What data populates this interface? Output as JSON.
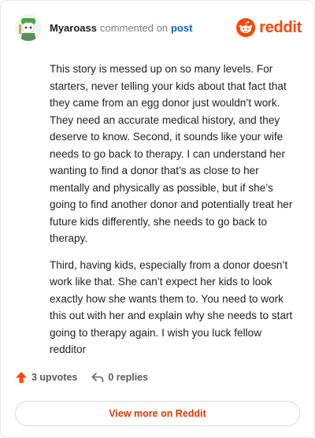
{
  "header": {
    "username": "Myaroass",
    "verb": "commented on",
    "post_link": "post",
    "logo_text": "reddit"
  },
  "comment": {
    "paragraphs": [
      "This story is messed up on so many levels. For starters, never telling your kids about that fact that they came from an egg donor just wouldn’t work. They need an accurate medical history, and they deserve to know. Second, it sounds like your wife needs to go back to therapy. I can understand her wanting to find a donor that’s as close to her mentally and physically as possible, but if she’s going to find another donor and potentially treat her future kids differently, she needs to go back to therapy.",
      "Third, having kids, especially from a donor doesn’t work like that. She can’t expect her kids to look exactly how she wants them to. You need to work this out with her and explain why she needs to start going to therapy again. I wish you luck fellow redditor"
    ]
  },
  "actions": {
    "upvotes": "3 upvotes",
    "replies": "0 replies"
  },
  "footer": {
    "view_more": "View more on Reddit"
  },
  "colors": {
    "brand": "#ff4500",
    "link": "#0a65c2"
  },
  "icons": [
    "avatar",
    "reddit-logo-icon",
    "upvote-arrow-icon",
    "reply-icon"
  ]
}
